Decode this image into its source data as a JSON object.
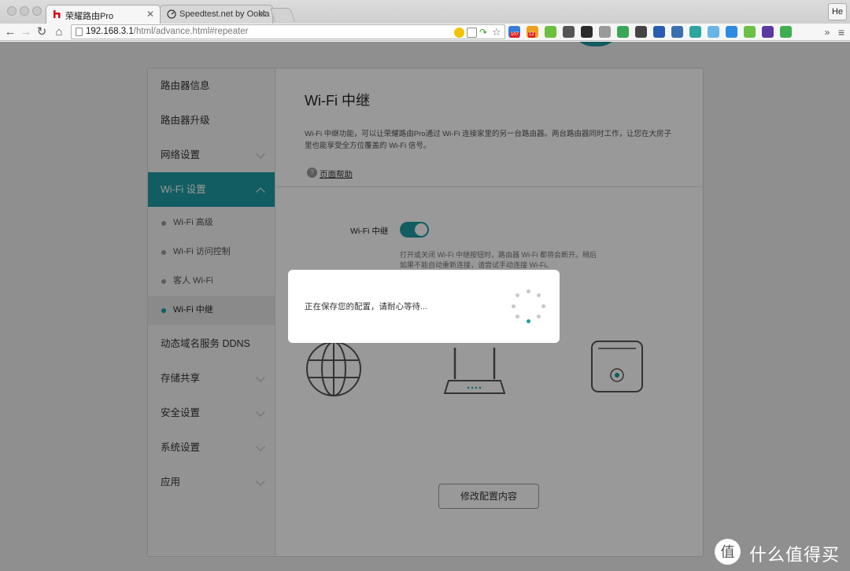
{
  "browser": {
    "tabs": [
      {
        "title": "荣耀路由Pro",
        "active": true
      },
      {
        "title": "Speedtest.net by Ookla - T",
        "active": false
      }
    ],
    "profile": "He",
    "address": {
      "host": "192.168.3.1",
      "path": "/html/advance.html#repeater"
    },
    "extensions": [
      {
        "icon": "google-icon",
        "badge": "107",
        "color": "#3a7bd5"
      },
      {
        "icon": "alert-icon",
        "badge": "12",
        "color": "#f0a020"
      },
      {
        "icon": "target-icon",
        "color": "#6cbf40"
      },
      {
        "icon": "tray-icon",
        "color": "#555555"
      },
      {
        "icon": "clock-icon",
        "color": "#2a2a2a"
      },
      {
        "icon": "moon-icon",
        "color": "#9a9a9a"
      },
      {
        "icon": "drive-icon",
        "color": "#3aa757"
      },
      {
        "icon": "hand-icon",
        "color": "#444444"
      },
      {
        "icon": "arrow-icon",
        "color": "#2a5db0"
      },
      {
        "icon": "screen-icon",
        "color": "#3a6fb0"
      },
      {
        "icon": "earth-icon",
        "color": "#2ba5a0"
      },
      {
        "icon": "vlc-icon",
        "color": "#6bb4e8"
      },
      {
        "icon": "chat-icon",
        "color": "#2b8be0"
      },
      {
        "icon": "smile-icon",
        "color": "#6ac145"
      },
      {
        "icon": "flag-icon",
        "color": "#5a3aa0"
      },
      {
        "icon": "leaf-icon",
        "color": "#3fae52"
      }
    ],
    "more_label": "»"
  },
  "sidebar": {
    "items": [
      {
        "label": "路由器信息",
        "expandable": false,
        "active": false
      },
      {
        "label": "路由器升级",
        "expandable": false,
        "active": false
      },
      {
        "label": "网络设置",
        "expandable": true,
        "active": false
      },
      {
        "label": "Wi-Fi 设置",
        "expandable": true,
        "active": true
      },
      {
        "label": "动态域名服务 DDNS",
        "expandable": false,
        "active": false
      },
      {
        "label": "存储共享",
        "expandable": true,
        "active": false
      },
      {
        "label": "安全设置",
        "expandable": true,
        "active": false
      },
      {
        "label": "系统设置",
        "expandable": true,
        "active": false
      },
      {
        "label": "应用",
        "expandable": true,
        "active": false
      }
    ],
    "subitems": [
      {
        "label": "Wi-Fi 高级",
        "active": false
      },
      {
        "label": "Wi-Fi 访问控制",
        "active": false
      },
      {
        "label": "客人 Wi-Fi",
        "active": false
      },
      {
        "label": "Wi-Fi 中继",
        "active": true
      }
    ]
  },
  "content": {
    "title": "Wi-Fi 中继",
    "description": "Wi-Fi 中继功能，可以让荣耀路由Pro通过 Wi-Fi 连接家里的另一台路由器。两台路由器同时工作，让您在大房子里也能享受全方位覆盖的 Wi-Fi 信号。",
    "help_link": "页面帮助",
    "toggle_label": "Wi-Fi 中继",
    "toggle_on": true,
    "toggle_hint": "打开或关闭 Wi-Fi 中继按钮时，路由器 Wi-Fi 都将会断开。稍后如果不能自动重新连接，请尝试手动连接 Wi-Fi。",
    "modify_button": "修改配置内容"
  },
  "dialog": {
    "message": "正在保存您的配置，请耐心等待..."
  },
  "watermark": {
    "text": "什么值得买"
  },
  "colors": {
    "accent": "#1d9ba3"
  }
}
